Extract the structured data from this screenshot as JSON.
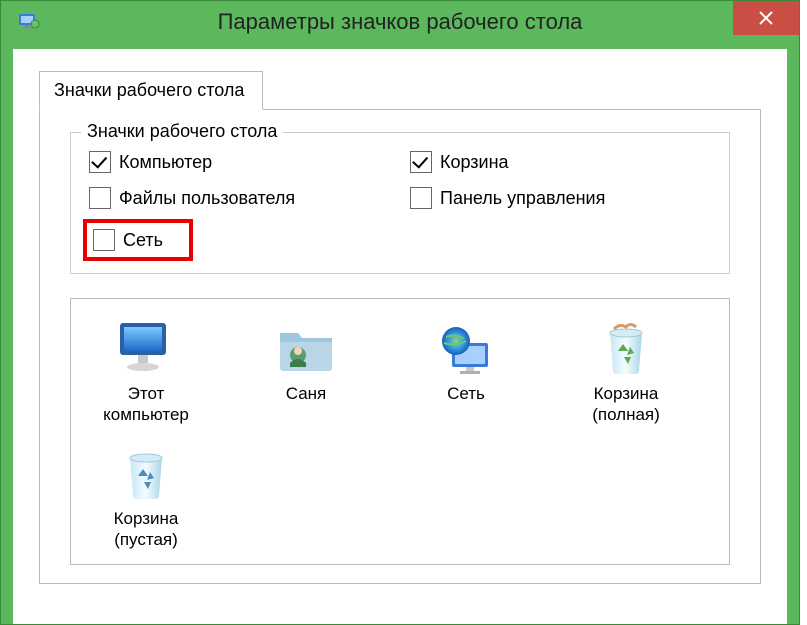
{
  "window": {
    "title": "Параметры значков рабочего стола"
  },
  "tab": {
    "label": "Значки рабочего стола"
  },
  "groupbox": {
    "title": "Значки рабочего стола",
    "checks": {
      "computer": {
        "label": "Компьютер",
        "checked": true
      },
      "recyclebin": {
        "label": "Корзина",
        "checked": true
      },
      "userfiles": {
        "label": "Файлы пользователя",
        "checked": false
      },
      "controlpanel": {
        "label": "Панель управления",
        "checked": false
      },
      "network": {
        "label": "Сеть",
        "checked": false
      }
    }
  },
  "icons": {
    "thispc": "Этот\nкомпьютер",
    "user": "Саня",
    "network": "Сеть",
    "recycle_full": "Корзина\n(полная)",
    "recycle_empty": "Корзина\n(пустая)"
  }
}
